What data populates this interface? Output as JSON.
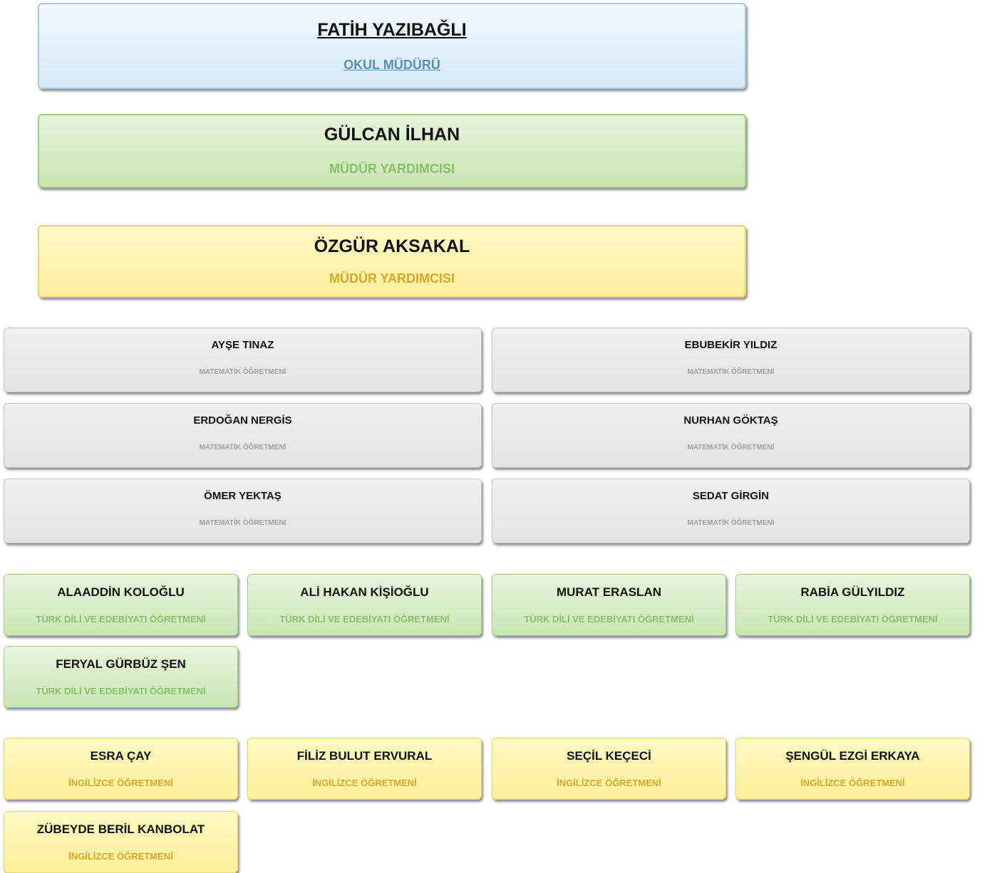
{
  "leaders": [
    {
      "name": "FATİH YAZIBAĞLI",
      "role": "OKUL MÜDÜRÜ"
    },
    {
      "name": "GÜLCAN İLHAN",
      "role": "MÜDÜR YARDIMCISI"
    },
    {
      "name": "ÖZGÜR AKSAKAL",
      "role": "MÜDÜR YARDIMCISI"
    }
  ],
  "math_teachers": [
    {
      "name": "AYŞE TINAZ",
      "role": "MATEMATİK ÖĞRETMENİ"
    },
    {
      "name": "EBUBEKİR YILDIZ",
      "role": "MATEMATİK ÖĞRETMENİ"
    },
    {
      "name": "ERDOĞAN NERGİS",
      "role": "MATEMATİK ÖĞRETMENİ"
    },
    {
      "name": "NURHAN GÖKTAŞ",
      "role": "MATEMATİK ÖĞRETMENİ"
    },
    {
      "name": "ÖMER YEKTAŞ",
      "role": "MATEMATİK ÖĞRETMENİ"
    },
    {
      "name": "SEDAT GİRGİN",
      "role": "MATEMATİK ÖĞRETMENİ"
    }
  ],
  "literature_teachers": [
    {
      "name": "ALAADDİN KOLOĞLU",
      "role": "TÜRK DİLİ VE EDEBİYATI ÖĞRETMENİ"
    },
    {
      "name": "ALİ HAKAN KİŞİOĞLU",
      "role": "TÜRK DİLİ VE EDEBİYATI ÖĞRETMENİ"
    },
    {
      "name": "MURAT ERASLAN",
      "role": "TÜRK DİLİ VE EDEBİYATI ÖĞRETMENİ"
    },
    {
      "name": "RABİA GÜLYILDIZ",
      "role": "TÜRK DİLİ VE EDEBİYATI ÖĞRETMENİ"
    },
    {
      "name": "FERYAL GÜRBÜZ ŞEN",
      "role": "TÜRK DİLİ VE EDEBİYATI ÖĞRETMENİ"
    }
  ],
  "english_teachers": [
    {
      "name": "ESRA ÇAY",
      "role": "İNGİLİZCE ÖĞRETMENİ"
    },
    {
      "name": "FİLİZ BULUT ERVURAL",
      "role": "İNGİLİZCE ÖĞRETMENİ"
    },
    {
      "name": "SEÇİL KEÇECİ",
      "role": "İNGİLİZCE ÖĞRETMENİ"
    },
    {
      "name": "ŞENGÜL EZGİ ERKAYA",
      "role": "İNGİLİZCE ÖĞRETMENİ"
    },
    {
      "name": "ZÜBEYDE BERİL KANBOLAT",
      "role": "İNGİLİZCE ÖĞRETMENİ"
    }
  ],
  "colors": {
    "principal_card": "#d6eaf8",
    "vice_principal_green": "#c9e4b1",
    "vice_principal_yellow": "#fdef9d",
    "math_card": "#e8e8e8",
    "literature_card": "#cae6b3",
    "english_card": "#fdef99"
  }
}
